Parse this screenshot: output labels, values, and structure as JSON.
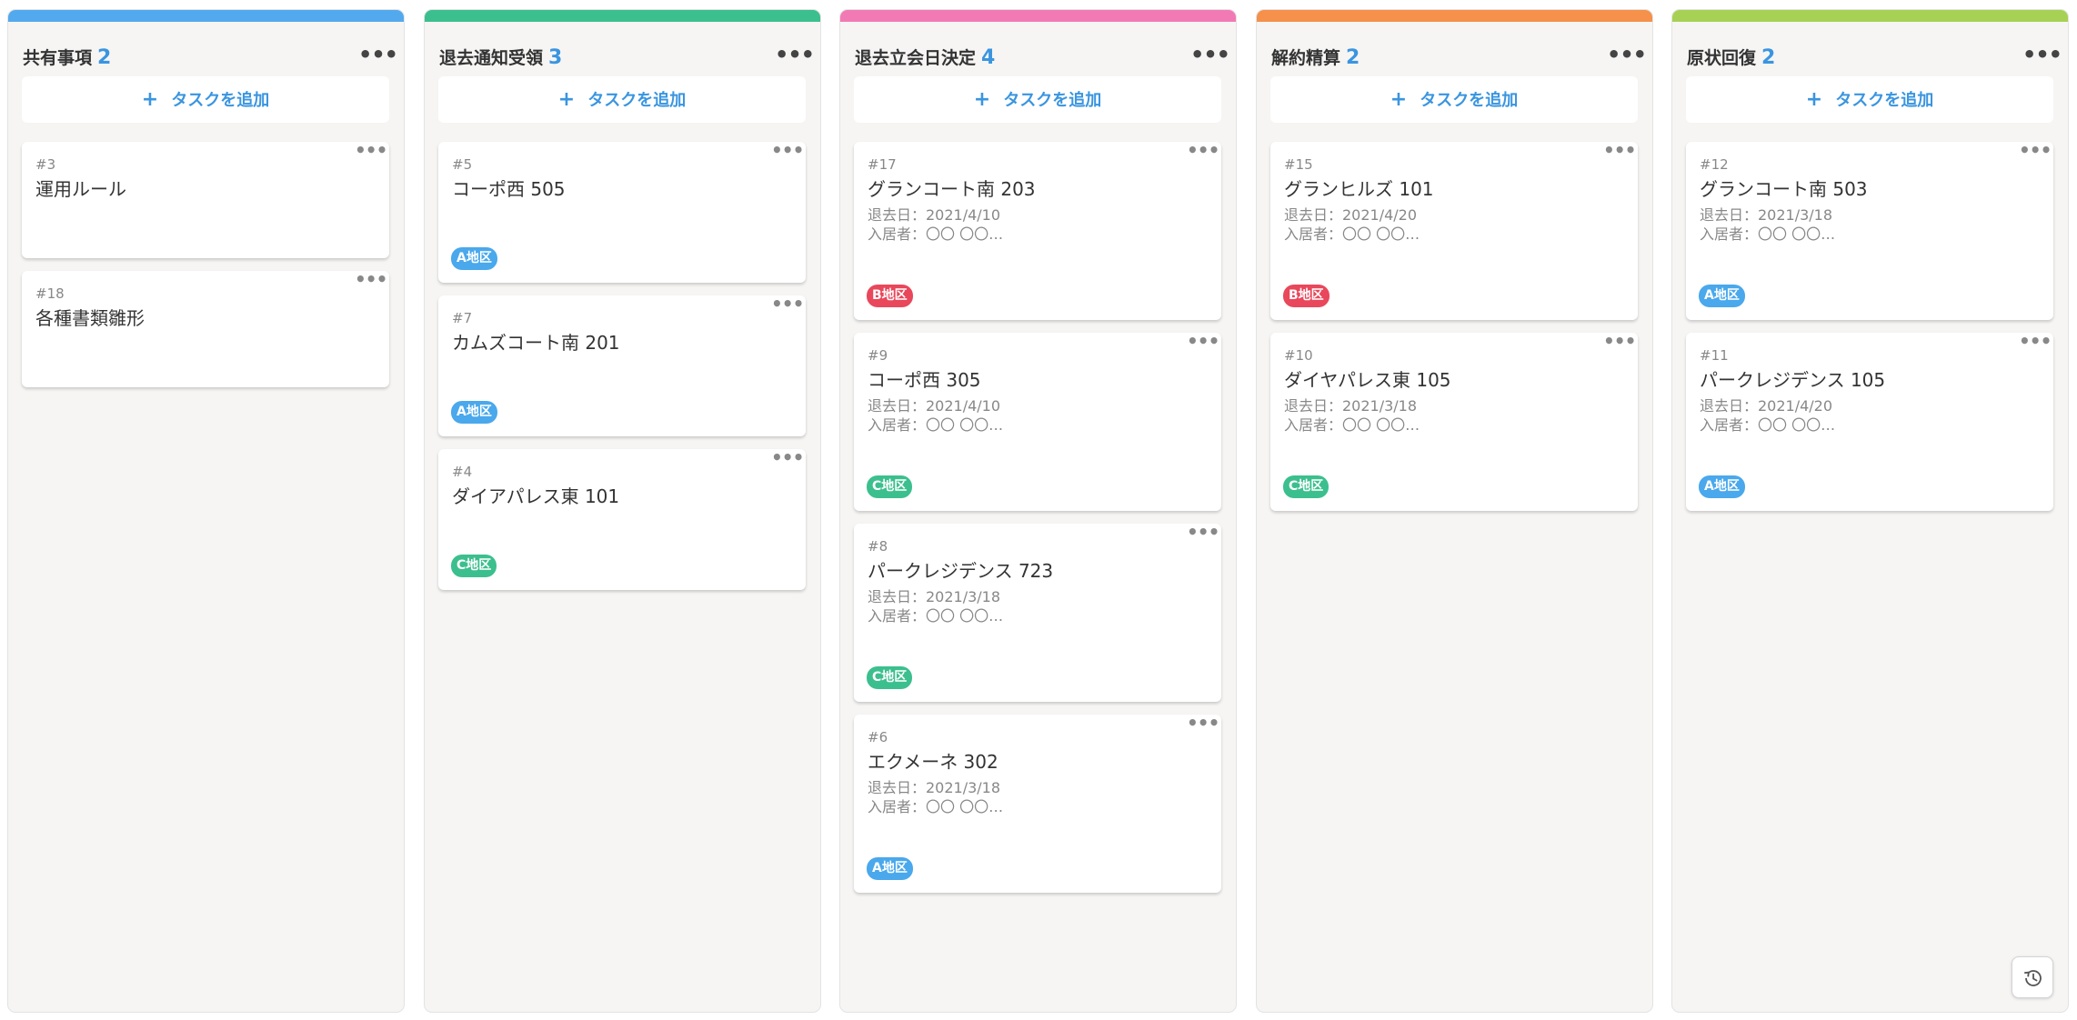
{
  "add_task_label": "タスクを追加",
  "more_glyph": "•••",
  "meta_labels": {
    "move_out": "退去日：",
    "tenant": "入居者："
  },
  "tag_colors": {
    "A地区": "#4aa8ec",
    "B地区": "#e9475b",
    "C地区": "#3cbf8e"
  },
  "columns": [
    {
      "title": "共有事項",
      "count": "2",
      "color": "#53a9ee",
      "cards": [
        {
          "id": "#3",
          "title": "運用ルール"
        },
        {
          "id": "#18",
          "title": "各種書類雛形"
        }
      ]
    },
    {
      "title": "退去通知受領",
      "count": "3",
      "color": "#3cbf8e",
      "cards": [
        {
          "id": "#5",
          "title": "コーポ西 505",
          "tag": "A地区"
        },
        {
          "id": "#7",
          "title": "カムズコート南 201",
          "tag": "A地区"
        },
        {
          "id": "#4",
          "title": "ダイアパレス東 101",
          "tag": "C地区"
        }
      ]
    },
    {
      "title": "退去立会日決定",
      "count": "4",
      "color": "#f27ab4",
      "cards": [
        {
          "id": "#17",
          "title": "グランコート南 203",
          "date": "2021/4/10",
          "tenant": "〇〇 〇〇…",
          "tag": "B地区"
        },
        {
          "id": "#9",
          "title": "コーポ西 305",
          "date": "2021/4/10",
          "tenant": "〇〇 〇〇…",
          "tag": "C地区"
        },
        {
          "id": "#8",
          "title": "パークレジデンス 723",
          "date": "2021/3/18",
          "tenant": "〇〇 〇〇…",
          "tag": "C地区"
        },
        {
          "id": "#6",
          "title": "エクメーネ 302",
          "date": "2021/3/18",
          "tenant": "〇〇 〇〇…",
          "tag": "A地区"
        }
      ]
    },
    {
      "title": "解約精算",
      "count": "2",
      "color": "#f5914a",
      "cards": [
        {
          "id": "#15",
          "title": "グランヒルズ 101",
          "date": "2021/4/20",
          "tenant": "〇〇 〇〇…",
          "tag": "B地区"
        },
        {
          "id": "#10",
          "title": "ダイヤパレス東 105",
          "date": "2021/3/18",
          "tenant": "〇〇 〇〇…",
          "tag": "C地区"
        }
      ]
    },
    {
      "title": "原状回復",
      "count": "2",
      "color": "#a7d155",
      "cards": [
        {
          "id": "#12",
          "title": "グランコート南 503",
          "date": "2021/3/18",
          "tenant": "〇〇 〇〇…",
          "tag": "A地区"
        },
        {
          "id": "#11",
          "title": "パークレジデンス 105",
          "date": "2021/4/20",
          "tenant": "〇〇 〇〇…",
          "tag": "A地区"
        }
      ]
    }
  ],
  "history_button_icon": "history-icon"
}
